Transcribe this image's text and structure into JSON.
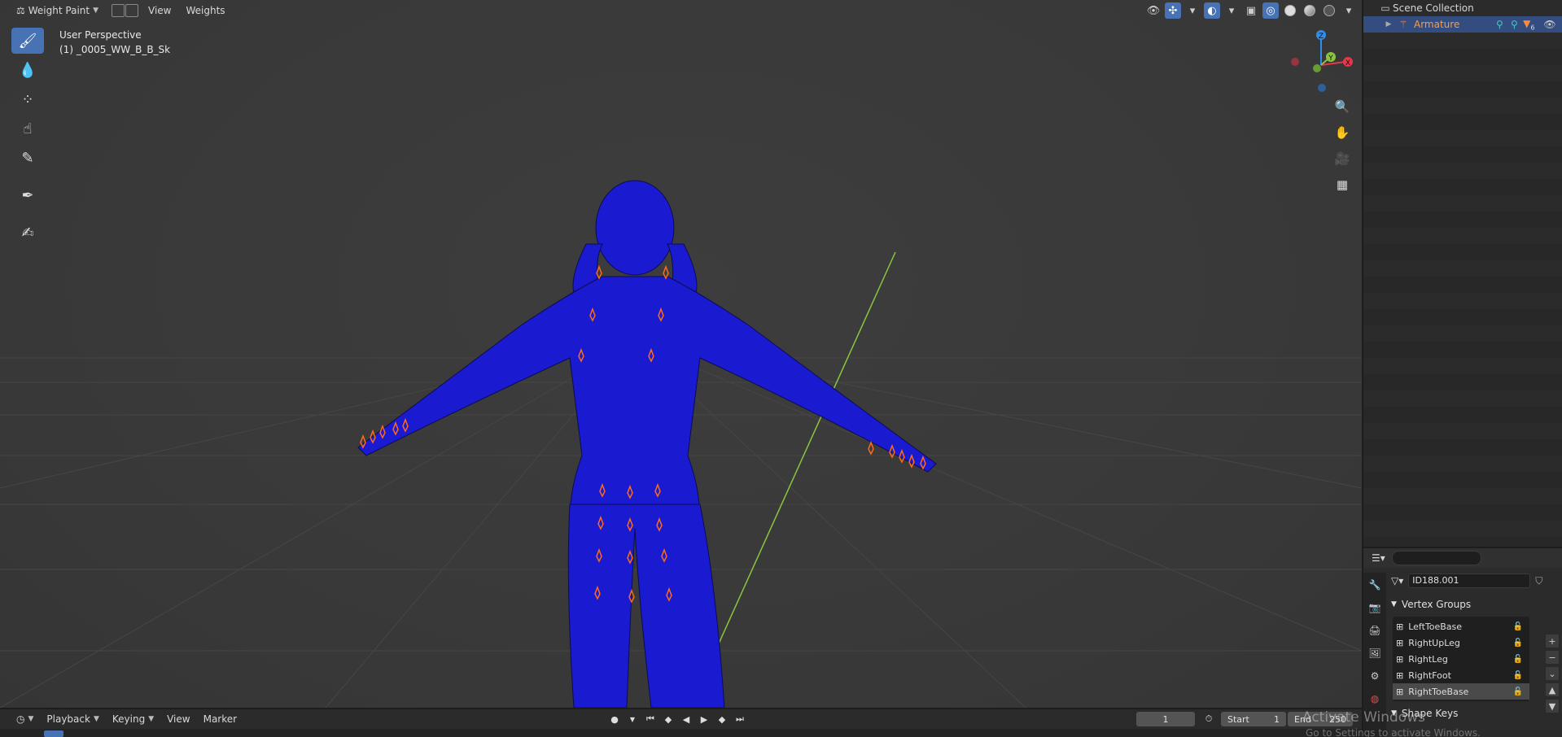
{
  "viewport_header": {
    "mode_label": "Weight Paint",
    "menus": [
      "View",
      "Weights"
    ]
  },
  "view_info": {
    "perspective": "User Perspective",
    "object": "(1) _0005_WW_B_B_Sk"
  },
  "gizmo": {
    "z": "Z",
    "y": "Y",
    "x": "X"
  },
  "outliner": {
    "root": "Scene Collection",
    "items": [
      {
        "label": "Armature",
        "badge": "6"
      }
    ]
  },
  "properties": {
    "search_placeholder": "",
    "mesh_data_name": "ID188.001",
    "vertex_groups_title": "Vertex Groups",
    "vertex_groups": [
      "LeftToeBase",
      "RightUpLeg",
      "RightLeg",
      "RightFoot",
      "RightToeBase"
    ],
    "active_group": "RightToeBase",
    "shape_keys_title": "Shape Keys"
  },
  "timeline": {
    "menus": [
      "Playback",
      "Keying",
      "View",
      "Marker"
    ],
    "current_frame": "1",
    "start_label": "Start",
    "start_value": "1",
    "end_label": "End",
    "end_value": "250"
  },
  "watermark": {
    "title": "Activate Windows",
    "sub": "Go to Settings to activate Windows."
  },
  "colors": {
    "accent": "#4772b3",
    "mesh_blue": "#1a1ad0",
    "bone_orange": "#ff6a1a",
    "axis_x": "#e8374a",
    "axis_y": "#8bc53f",
    "axis_z": "#2e8ef0"
  }
}
